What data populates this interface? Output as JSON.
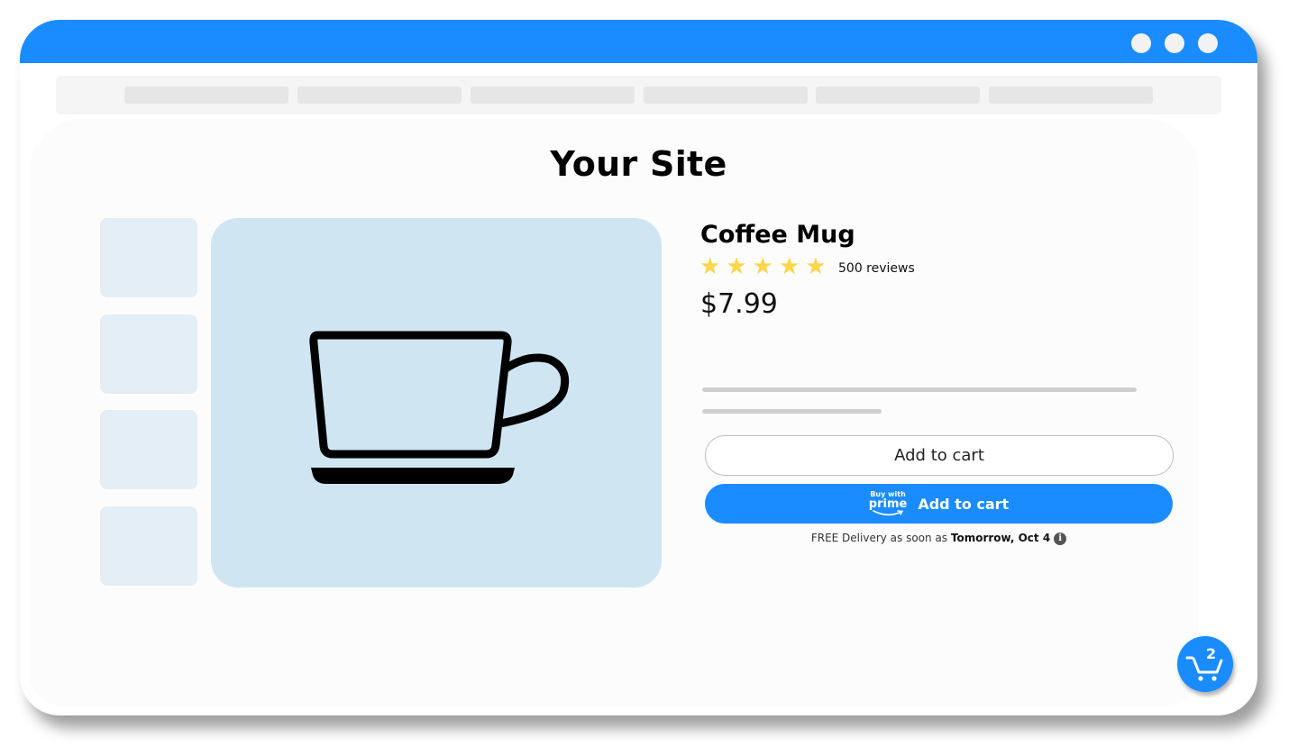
{
  "window": {
    "titlebar_color": "#1a8cff",
    "controls": [
      "window-dot",
      "window-dot",
      "window-dot"
    ]
  },
  "nav": {
    "placeholder_items": 6
  },
  "site": {
    "title": "Your Site"
  },
  "gallery": {
    "thumbnails": 4,
    "hero_icon": "coffee-cup-icon",
    "hero_bg": "#cfe5f2"
  },
  "product": {
    "name": "Coffee Mug",
    "rating": 5,
    "rating_max": 5,
    "star_glyph": "★",
    "reviews_label": "500 reviews",
    "price": "$7.99"
  },
  "actions": {
    "add_to_cart_label": "Add to cart",
    "prime": {
      "buy_with": "Buy with",
      "prime": "prime",
      "label": "Add to cart"
    },
    "delivery": {
      "prefix": "FREE Delivery as soon as ",
      "date": "Tomorrow, Oct 4",
      "info_icon": "i"
    }
  },
  "cart": {
    "count": "2",
    "icon": "shopping-cart-icon"
  },
  "colors": {
    "accent": "#1a8cff",
    "star": "#fcd64a"
  }
}
